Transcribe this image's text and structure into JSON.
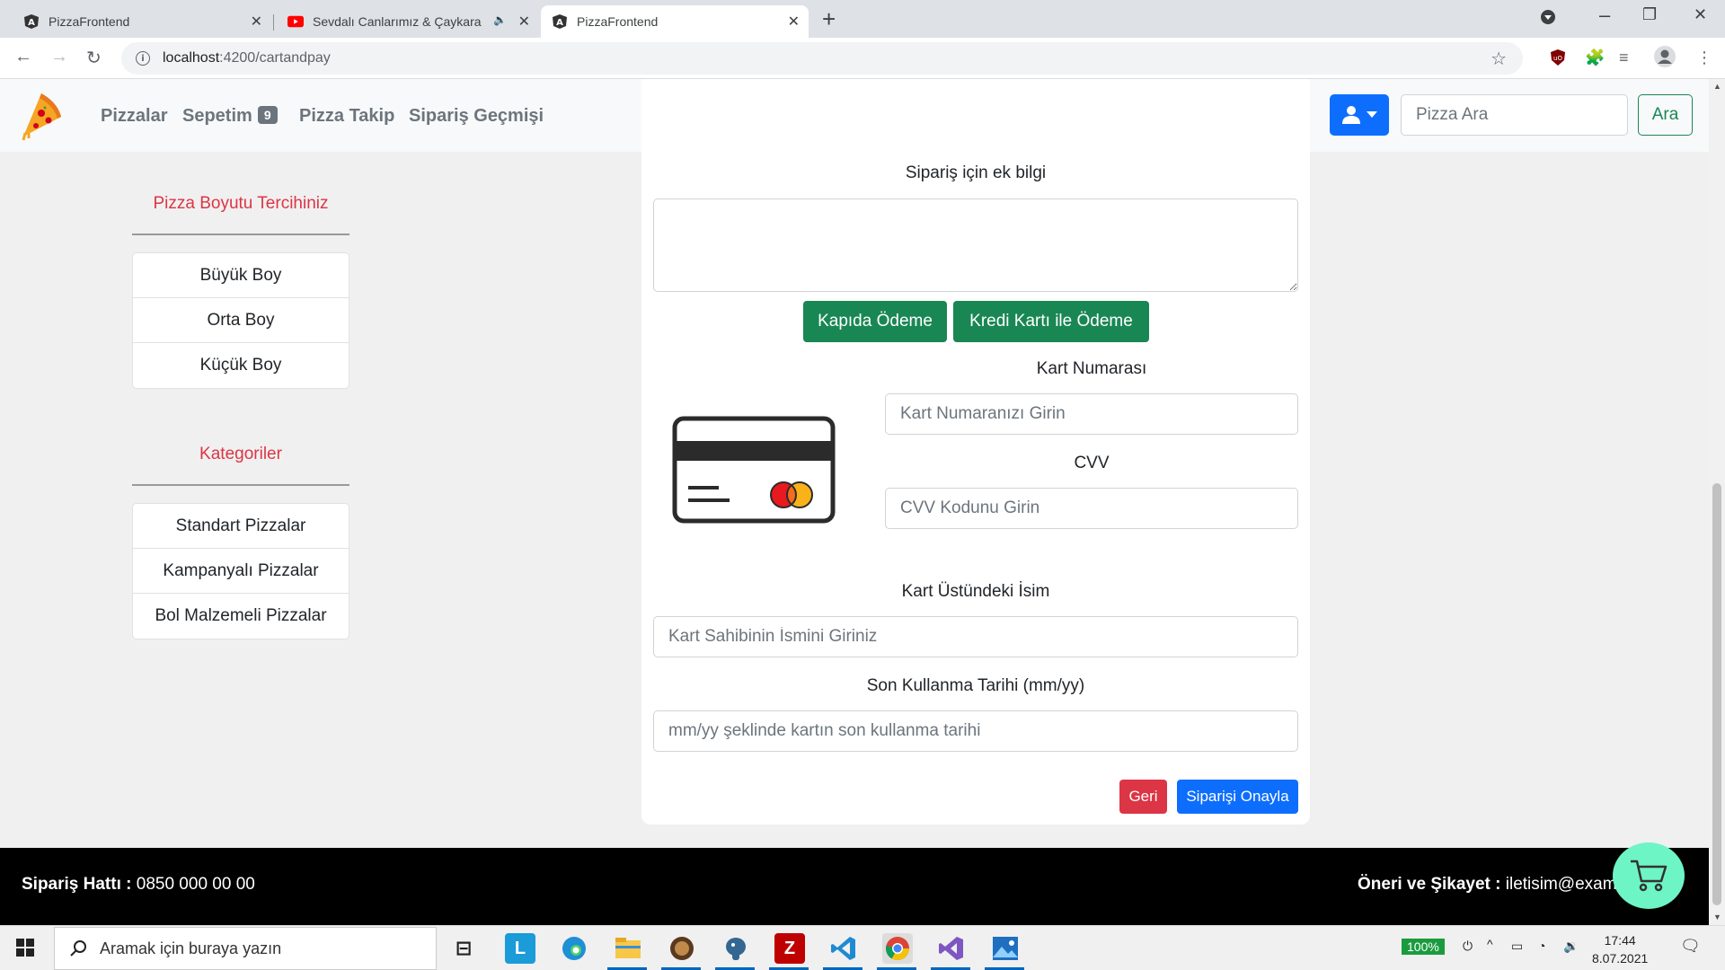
{
  "browser": {
    "tabs": [
      {
        "title": "PizzaFrontend",
        "icon": "angular-icon",
        "active": false
      },
      {
        "title": "Sevdalı Canlarımız & Çaykara",
        "icon": "youtube-icon",
        "active": false,
        "audio": true
      },
      {
        "title": "PizzaFrontend",
        "icon": "angular-icon",
        "active": true
      }
    ],
    "url_host": "localhost",
    "url_path": ":4200/cartandpay"
  },
  "navbar": {
    "links": [
      "Pizzalar",
      "Sepetim",
      "Pizza Takip",
      "Sipariş Geçmişi"
    ],
    "cart_count": "9",
    "search_placeholder": "Pizza Ara",
    "search_button": "Ara"
  },
  "sidebar": {
    "size_title": "Pizza Boyutu Tercihiniz",
    "sizes": [
      "Büyük Boy",
      "Orta Boy",
      "Küçük Boy"
    ],
    "category_title": "Kategoriler",
    "categories": [
      "Standart Pizzalar",
      "Kampanyalı Pizzalar",
      "Bol Malzemeli Pizzalar"
    ]
  },
  "payment": {
    "note_label": "Sipariş için ek bilgi",
    "pay_door": "Kapıda Ödeme",
    "pay_card": "Kredi Kartı ile Ödeme",
    "card_number_label": "Kart Numarası",
    "card_number_placeholder": "Kart Numaranızı Girin",
    "cvv_label": "CVV",
    "cvv_placeholder": "CVV Kodunu Girin",
    "name_label": "Kart Üstündeki İsim",
    "name_placeholder": "Kart Sahibinin İsmini Giriniz",
    "expiry_label": "Son Kullanma Tarihi (mm/yy)",
    "expiry_placeholder": "mm/yy şeklinde kartın son kullanma tarihi",
    "back_button": "Geri",
    "confirm_button": "Siparişi Onayla"
  },
  "footer": {
    "hotline_label": "Sipariş Hattı :",
    "hotline_value": "0850 000 00 00",
    "feedback_label": "Öneri ve Şikayet :",
    "feedback_value": "iletisim@exam"
  },
  "taskbar": {
    "search_placeholder": "Aramak için buraya yazın",
    "battery": "100%",
    "time": "17:44",
    "date": "8.07.2021"
  },
  "colors": {
    "accent_blue": "#0d6efd",
    "success_green": "#198754",
    "danger_red": "#dc3545",
    "fab_mint": "#6ef5c5"
  }
}
